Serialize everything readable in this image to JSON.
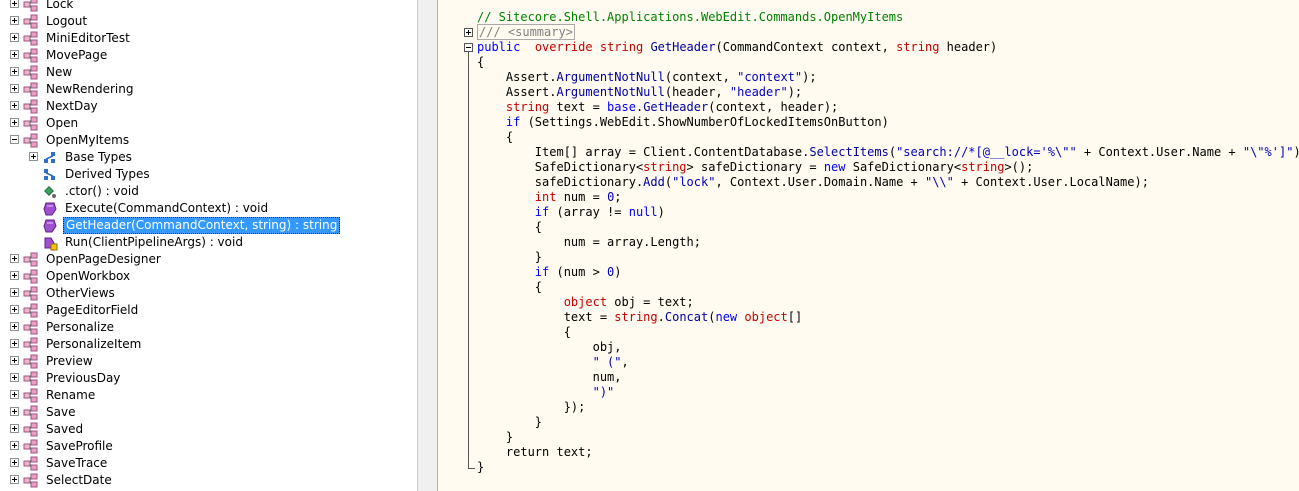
{
  "tree": {
    "items": [
      {
        "label": "Lock",
        "kind": "class",
        "expander": "plus",
        "level": 0
      },
      {
        "label": "Logout",
        "kind": "class",
        "expander": "plus",
        "level": 0
      },
      {
        "label": "MiniEditorTest",
        "kind": "class",
        "expander": "plus",
        "level": 0
      },
      {
        "label": "MovePage",
        "kind": "class",
        "expander": "plus",
        "level": 0
      },
      {
        "label": "New",
        "kind": "class",
        "expander": "plus",
        "level": 0
      },
      {
        "label": "NewRendering",
        "kind": "class",
        "expander": "plus",
        "level": 0
      },
      {
        "label": "NextDay",
        "kind": "class",
        "expander": "plus",
        "level": 0
      },
      {
        "label": "Open",
        "kind": "class",
        "expander": "plus",
        "level": 0
      },
      {
        "label": "OpenMyItems",
        "kind": "class",
        "expander": "minus",
        "level": 0
      },
      {
        "label": "Base Types",
        "kind": "base-types",
        "expander": "plus",
        "level": 1
      },
      {
        "label": "Derived Types",
        "kind": "derived-types",
        "expander": "none",
        "level": 1
      },
      {
        "label": ".ctor() : void",
        "kind": "constructor",
        "expander": "none",
        "level": 1
      },
      {
        "label": "Execute(CommandContext) : void",
        "kind": "method",
        "expander": "none",
        "level": 1
      },
      {
        "label": "GetHeader(CommandContext, string) : string",
        "kind": "method",
        "expander": "none",
        "level": 1,
        "selected": true
      },
      {
        "label": "Run(ClientPipelineArgs) : void",
        "kind": "protected-method",
        "expander": "none",
        "level": 1
      },
      {
        "label": "OpenPageDesigner",
        "kind": "class",
        "expander": "plus",
        "level": 0
      },
      {
        "label": "OpenWorkbox",
        "kind": "class",
        "expander": "plus",
        "level": 0
      },
      {
        "label": "OtherViews",
        "kind": "class",
        "expander": "plus",
        "level": 0
      },
      {
        "label": "PageEditorField",
        "kind": "class",
        "expander": "plus",
        "level": 0
      },
      {
        "label": "Personalize",
        "kind": "class",
        "expander": "plus",
        "level": 0
      },
      {
        "label": "PersonalizeItem",
        "kind": "class",
        "expander": "plus",
        "level": 0
      },
      {
        "label": "Preview",
        "kind": "class",
        "expander": "plus",
        "level": 0
      },
      {
        "label": "PreviousDay",
        "kind": "class",
        "expander": "plus",
        "level": 0
      },
      {
        "label": "Rename",
        "kind": "class",
        "expander": "plus",
        "level": 0
      },
      {
        "label": "Save",
        "kind": "class",
        "expander": "plus",
        "level": 0
      },
      {
        "label": "Saved",
        "kind": "class",
        "expander": "plus",
        "level": 0
      },
      {
        "label": "SaveProfile",
        "kind": "class",
        "expander": "plus",
        "level": 0
      },
      {
        "label": "SaveTrace",
        "kind": "class",
        "expander": "plus",
        "level": 0
      },
      {
        "label": "SelectDate",
        "kind": "class",
        "expander": "plus",
        "level": 0
      }
    ]
  },
  "code": {
    "lines": [
      [
        [
          "cm",
          "// Sitecore.Shell.Applications.WebEdit.Commands.OpenMyItems"
        ]
      ],
      [
        [
          "cg",
          "/// <summary>"
        ]
      ],
      [
        [
          "kw",
          "public"
        ],
        [
          "",
          "  "
        ],
        [
          "tp",
          "override"
        ],
        [
          "",
          " "
        ],
        [
          "tp",
          "string"
        ],
        [
          "",
          " "
        ],
        [
          "mt",
          "GetHeader"
        ],
        [
          "",
          "(CommandContext context, "
        ],
        [
          "tp",
          "string"
        ],
        [
          "",
          " header)"
        ]
      ],
      [
        [
          "",
          "{"
        ]
      ],
      [
        [
          "",
          "    Assert."
        ],
        [
          "mt",
          "ArgumentNotNull"
        ],
        [
          "",
          "(context, "
        ],
        [
          "st",
          "\"context\""
        ],
        [
          "",
          ");"
        ]
      ],
      [
        [
          "",
          "    Assert."
        ],
        [
          "mt",
          "ArgumentNotNull"
        ],
        [
          "",
          "(header, "
        ],
        [
          "st",
          "\"header\""
        ],
        [
          "",
          ");"
        ]
      ],
      [
        [
          "tp",
          "    string"
        ],
        [
          "",
          " text = "
        ],
        [
          "kw",
          "base"
        ],
        [
          "",
          "."
        ],
        [
          "mt",
          "GetHeader"
        ],
        [
          "",
          "(context, header);"
        ]
      ],
      [
        [
          "kw",
          "    if"
        ],
        [
          "",
          " (Settings.WebEdit.ShowNumberOfLockedItemsOnButton)"
        ]
      ],
      [
        [
          "",
          "    {"
        ]
      ],
      [
        [
          "",
          "        Item[] array = Client.ContentDatabase."
        ],
        [
          "mt",
          "SelectItems"
        ],
        [
          "",
          "("
        ],
        [
          "st",
          "\"search://*[@__lock='%\\\"\""
        ],
        [
          "",
          ""
        ],
        [
          "",
          " + Context.User.Name + "
        ],
        [
          "st",
          "\"\\\"%']\""
        ],
        [
          "",
          ");"
        ]
      ],
      [
        [
          "",
          "        SafeDictionary<"
        ],
        [
          "tp",
          "string"
        ],
        [
          "",
          "> safeDictionary = "
        ],
        [
          "kw",
          "new"
        ],
        [
          "",
          " SafeDictionary<"
        ],
        [
          "tp",
          "string"
        ],
        [
          "",
          ">();"
        ]
      ],
      [
        [
          "",
          "        safeDictionary."
        ],
        [
          "mt",
          "Add"
        ],
        [
          "",
          "("
        ],
        [
          "st",
          "\"lock\""
        ],
        [
          "",
          ", Context.User.Domain.Name + "
        ],
        [
          "st",
          "\"\\\\\""
        ],
        [
          "",
          " + Context.User.LocalName);"
        ]
      ],
      [
        [
          "tp",
          "        int"
        ],
        [
          "",
          " num = "
        ],
        [
          "st",
          "0"
        ],
        [
          "",
          ";"
        ]
      ],
      [
        [
          "kw",
          "        if"
        ],
        [
          "",
          " (array != "
        ],
        [
          "kw",
          "null"
        ],
        [
          "",
          ")"
        ]
      ],
      [
        [
          "",
          "        {"
        ]
      ],
      [
        [
          "",
          "            num = array.Length;"
        ]
      ],
      [
        [
          "",
          "        }"
        ]
      ],
      [
        [
          "kw",
          "        if"
        ],
        [
          "",
          " (num > "
        ],
        [
          "st",
          "0"
        ],
        [
          "",
          ")"
        ]
      ],
      [
        [
          "",
          "        {"
        ]
      ],
      [
        [
          "tp",
          "            object"
        ],
        [
          "",
          " obj = text;"
        ]
      ],
      [
        [
          "",
          "            text = "
        ],
        [
          "tp",
          "string"
        ],
        [
          "",
          "."
        ],
        [
          "mt",
          "Concat"
        ],
        [
          "",
          "("
        ],
        [
          "kw",
          "new"
        ],
        [
          "",
          " "
        ],
        [
          "tp",
          "object"
        ],
        [
          "",
          "[]"
        ]
      ],
      [
        [
          "",
          "            {"
        ]
      ],
      [
        [
          "",
          "                obj,"
        ]
      ],
      [
        [
          "st",
          "                \" (\""
        ],
        [
          "",
          ","
        ]
      ],
      [
        [
          "",
          "                num,"
        ]
      ],
      [
        [
          "st",
          "                \")\""
        ]
      ],
      [
        [
          "",
          "            });"
        ]
      ],
      [
        [
          "",
          "        }"
        ]
      ],
      [
        [
          "",
          "    }"
        ]
      ],
      [
        [
          "",
          "    return text;"
        ]
      ],
      [
        [
          "",
          "}"
        ]
      ]
    ]
  }
}
